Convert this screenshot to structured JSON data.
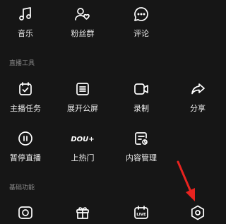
{
  "top_row": [
    {
      "label": "音乐",
      "icon": "music-note-icon"
    },
    {
      "label": "粉丝群",
      "icon": "fans-group-icon"
    },
    {
      "label": "评论",
      "icon": "comment-icon"
    }
  ],
  "sections": [
    {
      "title": "直播工具"
    },
    {
      "title": "基础功能"
    }
  ],
  "live_tools_row1": [
    {
      "label": "主播任务",
      "icon": "task-calendar-icon"
    },
    {
      "label": "展开公屏",
      "icon": "public-screen-icon"
    },
    {
      "label": "录制",
      "icon": "record-icon"
    },
    {
      "label": "分享",
      "icon": "share-arrow-icon"
    }
  ],
  "live_tools_row2": [
    {
      "label": "暂停直播",
      "icon": "pause-icon"
    },
    {
      "label": "上热门",
      "icon": "dou-plus-icon",
      "logo_text": "DOU+"
    },
    {
      "label": "内容管理",
      "icon": "content-manage-icon"
    }
  ],
  "basic_row": [
    {
      "icon": "camera-flip-icon"
    },
    {
      "icon": "gift-icon"
    },
    {
      "icon": "live-replay-icon",
      "badge_text": "LIVE"
    },
    {
      "icon": "settings-hexagon-icon"
    }
  ],
  "annotation": {
    "color": "#e8231f"
  }
}
